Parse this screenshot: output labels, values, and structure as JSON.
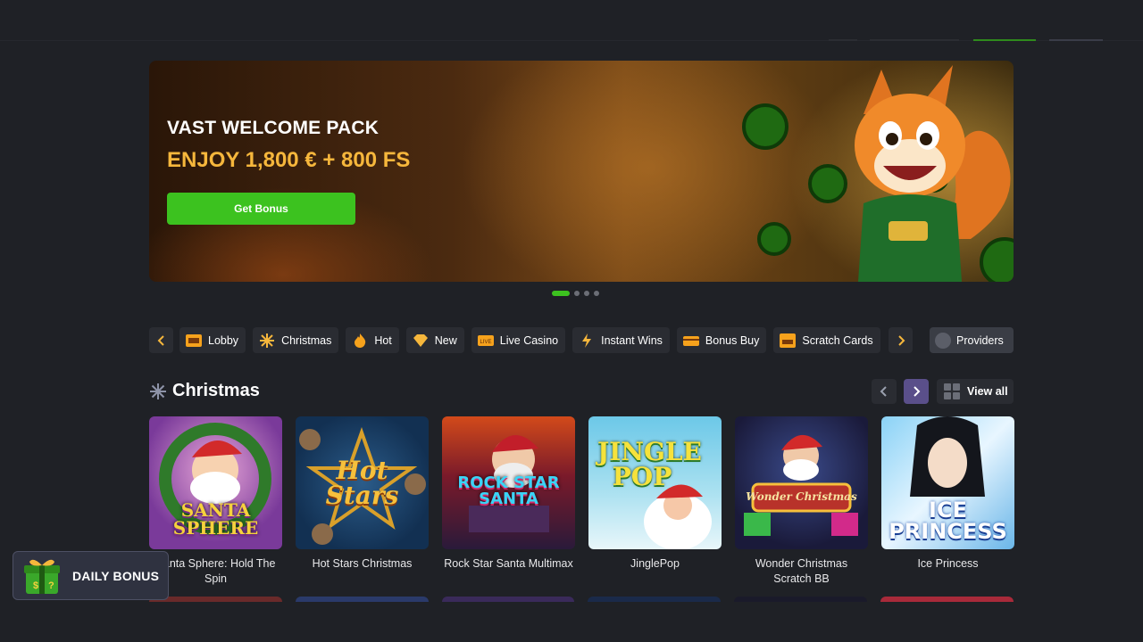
{
  "banner": {
    "title": "VAST WELCOME PACK",
    "subtitle": "ENJOY 1,800 € + 800 FS",
    "button_label": "Get Bonus"
  },
  "carousel": {
    "slides": 4,
    "active": 1
  },
  "categories": [
    {
      "label": "Lobby",
      "icon": "slot-machine-icon"
    },
    {
      "label": "Christmas",
      "icon": "snowflake-icon"
    },
    {
      "label": "Hot",
      "icon": "flame-icon"
    },
    {
      "label": "New",
      "icon": "diamond-icon"
    },
    {
      "label": "Live Casino",
      "icon": "live-casino-icon"
    },
    {
      "label": "Instant Wins",
      "icon": "lightning-icon"
    },
    {
      "label": "Bonus Buy",
      "icon": "bonus-buy-icon"
    },
    {
      "label": "Scratch Cards",
      "icon": "scratch-card-icon"
    }
  ],
  "providers_label": "Providers",
  "section": {
    "title": "Christmas",
    "view_all": "View all"
  },
  "games": [
    {
      "name": "Santa Sphere: Hold The Spin",
      "art": "SANTA SPHERE"
    },
    {
      "name": "Hot Stars Christmas",
      "art": "Hot Stars"
    },
    {
      "name": "Rock Star Santa Multimax",
      "art": "ROCK STAR SANTA"
    },
    {
      "name": "JinglePop",
      "art": "JINGLE POP"
    },
    {
      "name": "Wonder Christmas Scratch BB",
      "art": "Wonder Christmas"
    },
    {
      "name": "Ice Princess",
      "art": "ICE PRINCESS"
    }
  ],
  "daily_bonus_label": "DAILY BONUS",
  "colors": {
    "background": "#1f2126",
    "accent_green": "#3cc21f",
    "accent_gold": "#f6b73c",
    "chip": "#2a2c32"
  }
}
